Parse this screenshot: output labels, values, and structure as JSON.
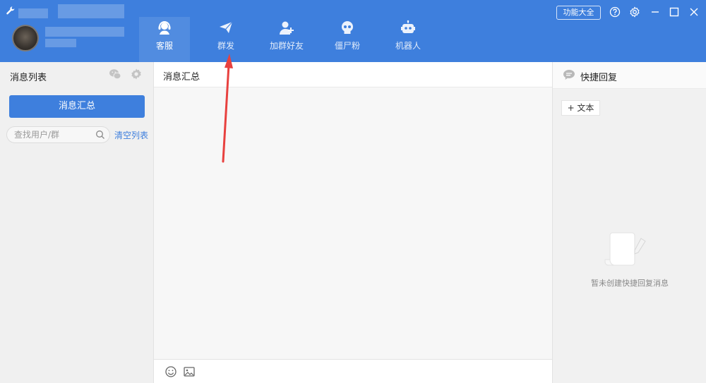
{
  "header": {
    "tabs": [
      {
        "label": "客服",
        "icon": "customer-service-icon",
        "active": true
      },
      {
        "label": "群发",
        "icon": "paper-plane-icon",
        "active": false
      },
      {
        "label": "加群好友",
        "icon": "add-friend-icon",
        "active": false
      },
      {
        "label": "僵尸粉",
        "icon": "skull-icon",
        "active": false
      },
      {
        "label": "机器人",
        "icon": "robot-icon",
        "active": false
      }
    ],
    "feature_button": "功能大全",
    "window_controls": [
      "help-icon",
      "settings-icon",
      "minimize-icon",
      "maximize-icon",
      "close-icon"
    ]
  },
  "left": {
    "title": "消息列表",
    "primary_button": "消息汇总",
    "search_placeholder": "查找用户/群",
    "clear_link": "清空列表"
  },
  "center": {
    "title": "消息汇总"
  },
  "right": {
    "title": "快捷回复",
    "add_text_button": "+ 文本",
    "empty_text": "暂未创建快捷回复消息"
  },
  "colors": {
    "brand": "#3e7fdd",
    "arrow": "#e8413f"
  }
}
